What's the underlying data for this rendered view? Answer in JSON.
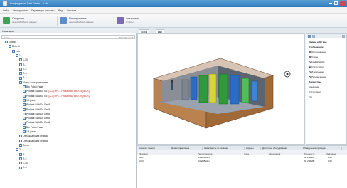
{
  "window": {
    "title": "Конфигурация Data Center — Lab"
  },
  "menu": [
    "Файл",
    "Инструменты",
    "Параметры системы",
    "Вид",
    "Справка"
  ],
  "ribbon": [
    {
      "l1": "Операции",
      "l2": "центр обработки данных",
      "color": "#3aa55a"
    },
    {
      "l1": "Планирование",
      "l2": "центр обработки данных",
      "color": "#5b8fc7"
    },
    {
      "l1": "Аналитика",
      "l2": "Отчёты",
      "color": "#7b6bb5"
    }
  ],
  "left": {
    "header": "Навигация",
    "search_placeholder": "Поиск",
    "search_button": "Расширенный",
    "tree": [
      {
        "t": "Global",
        "d": 1
      },
      {
        "t": "Bellevil",
        "d": 2
      },
      {
        "t": "Lab",
        "d": 3
      },
      {
        "t": "1",
        "d": 4
      },
      {
        "t": "1-10",
        "d": 5
      },
      {
        "t": "R-1",
        "d": 5
      },
      {
        "t": "R-2",
        "d": 5
      },
      {
        "t": "R-3",
        "d": 5
      },
      {
        "t": "R-4",
        "d": 5
      },
      {
        "t": "Шкаф электропитания",
        "d": 5
      },
      {
        "t": "Blo Patch Panel",
        "d": 6
      },
      {
        "t": "Proliant BL680c G5",
        "d": 6,
        "red": "[A-3] HP — Proliant BL 680 G5 [IBOX]"
      },
      {
        "t": "Proliant BL680c G5",
        "d": 6,
        "red": "[A-3] HP — Proliant BL 680 G5 [IBOX]"
      },
      {
        "t": "1R panel",
        "d": 6
      },
      {
        "t": "Proliant BL460c Gen8",
        "d": 6
      },
      {
        "t": "Proliant BL460c Gen8",
        "d": 6
      },
      {
        "t": "Proliant BL460c Gen8",
        "d": 6
      },
      {
        "t": "Proliant BL460c Gen8",
        "d": 6
      },
      {
        "t": "Proliant BL460c Gen8",
        "d": 6
      },
      {
        "t": "Blo Patch Panel",
        "d": 6
      },
      {
        "t": "1R panel",
        "d": 6
      },
      {
        "t": "Охлаждающая стойка",
        "d": 5
      },
      {
        "t": "Охлаждающая стойка",
        "d": 5
      },
      {
        "t": "Лоток",
        "d": 5
      },
      {
        "t": "2",
        "d": 4
      },
      {
        "t": "R-1",
        "d": 5
      },
      {
        "t": "R-2",
        "d": 5
      },
      {
        "t": "1-10",
        "d": 5
      },
      {
        "t": "R-3",
        "d": 5
      }
    ]
  },
  "view": {
    "tabs": [
      "Global",
      "Lab"
    ],
    "props": [
      {
        "t": "Камера и 3D вид",
        "bold": true
      },
      {
        "t": "Отображение",
        "bold": true
      },
      {
        "t": "Оборудование",
        "chk": true
      },
      {
        "t": "Стены",
        "chk": true
      },
      {
        "t": "Тип плотности",
        "bold": true
      },
      {
        "t": "Отсутствует",
        "rad": true
      },
      {
        "t": "Измеренная",
        "rad": false
      },
      {
        "t": "Рассчитанная",
        "rad": false
      },
      {
        "t": "Параметры",
        "bold": true
      },
      {
        "t": "Сведения",
        "bold": false
      },
      {
        "t": "Отсутствует",
        "bold": false
      },
      {
        "t": "Тип",
        "bold": false
      }
    ],
    "bottom_tabs": [
      "Сигналы тревоги",
      "Записи управления",
      "Зависимость по питанию",
      "Наряды",
      "Доступное оборудование",
      "Обнаружение проводок"
    ],
    "columns": [
      "Элемент",
      "Расположение",
      "Фаза",
      "Мониторинг",
      "Мощность",
      "Заданная"
    ],
    "rows": [
      {
        "el": "Ut-1",
        "loc": "A/Lab/Bellevil",
        "pw": "68 208 кВт",
        "set": "0,00"
      },
      {
        "el": "Ut-3",
        "loc": "A/Lab/Bellevil",
        "pw": "68 206 кВт",
        "set": "0,00"
      }
    ]
  }
}
